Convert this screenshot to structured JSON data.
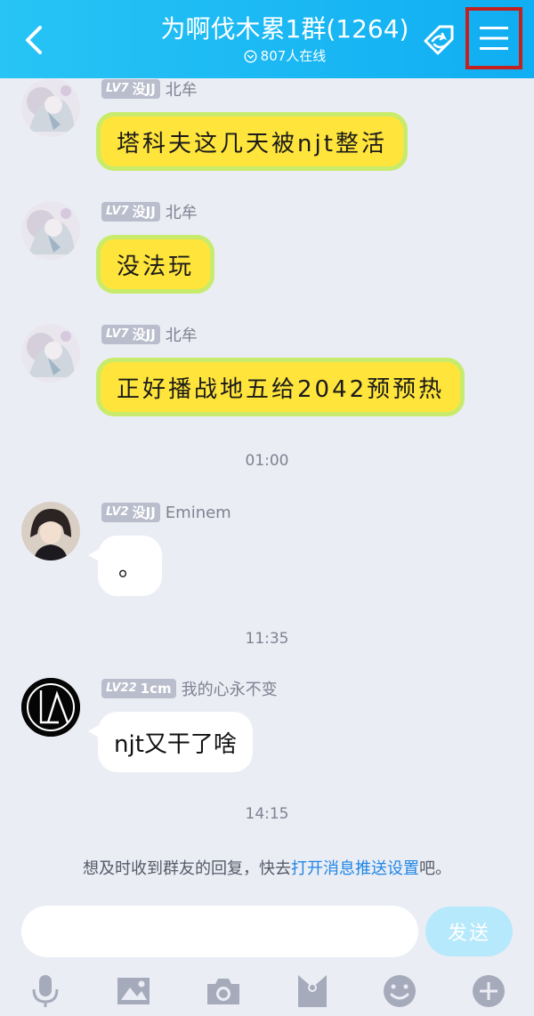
{
  "header": {
    "title": "为啊伐木累1群(1264)",
    "online": "807人在线"
  },
  "messages": [
    {
      "level": "LV7",
      "title": "没JJ",
      "sender": "北牟",
      "text": "塔科夫这几天被njt整活"
    },
    {
      "level": "LV7",
      "title": "没JJ",
      "sender": "北牟",
      "text": "没法玩"
    },
    {
      "level": "LV7",
      "title": "没JJ",
      "sender": "北牟",
      "text": "正好播战地五给2042预预热"
    },
    {
      "level": "LV2",
      "title": "没JJ",
      "sender": "Eminem",
      "text": "。"
    },
    {
      "level": "LV22",
      "title": "1cm",
      "sender": "我的心永不变",
      "text": "njt又干了啥"
    }
  ],
  "times": [
    "01:00",
    "11:35",
    "14:15"
  ],
  "notice": {
    "prefix": "想及时收到群友的回复，快去",
    "link": "打开消息推送设置",
    "suffix": "吧。"
  },
  "input": {
    "placeholder": "",
    "send_label": "发送"
  },
  "toolbar": [
    "microphone-icon",
    "image-icon",
    "camera-icon",
    "red-packet-icon",
    "emoji-icon",
    "plus-icon"
  ],
  "colors": {
    "header": "#17b6f3",
    "bubble_yellow": "#ffe43b",
    "bubble_border": "#c8eb6b",
    "link": "#1e86e6",
    "highlight": "#c2211f"
  }
}
